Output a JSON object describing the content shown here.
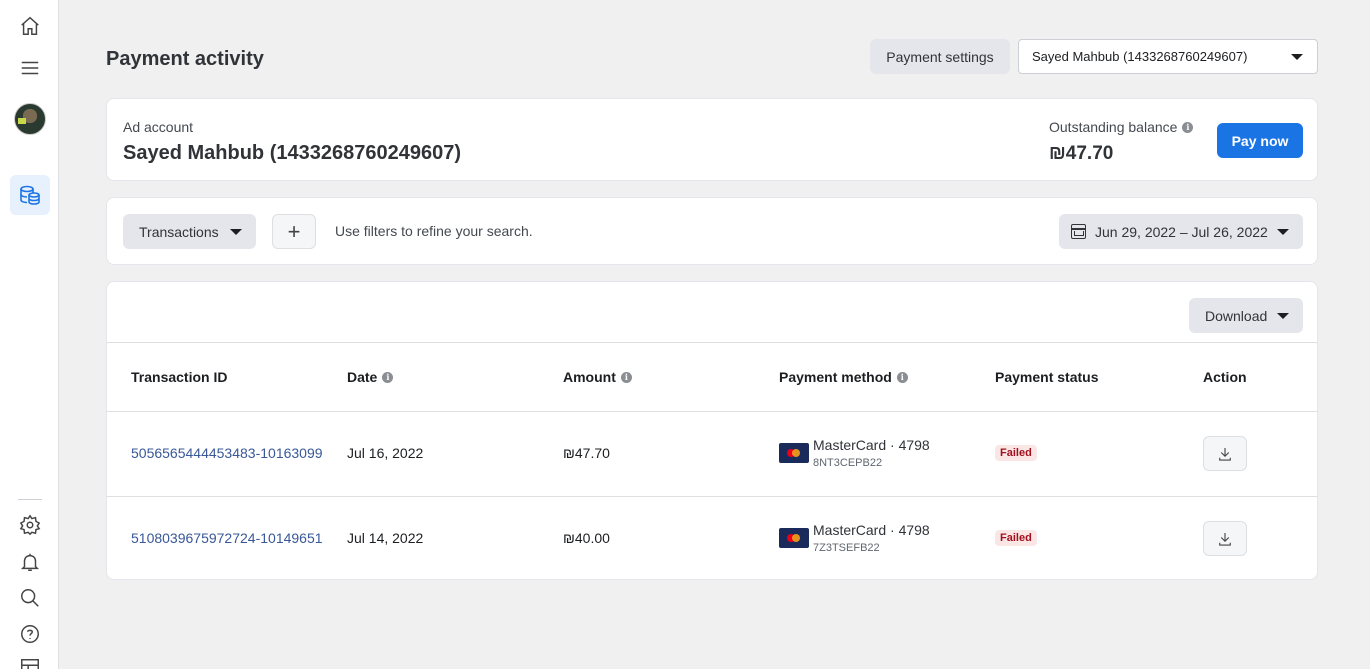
{
  "header": {
    "title": "Payment activity",
    "payment_settings_label": "Payment settings",
    "account_selector": "Sayed Mahbub (1433268760249607)"
  },
  "account_card": {
    "label": "Ad account",
    "name": "Sayed Mahbub (1433268760249607)",
    "balance_label": "Outstanding balance",
    "balance_value": "₪47.70",
    "pay_now_label": "Pay now"
  },
  "filters": {
    "type_label": "Transactions",
    "add_label": "+",
    "hint": "Use filters to refine your search.",
    "date_range": "Jun 29, 2022 – Jul 26, 2022"
  },
  "table": {
    "download_label": "Download",
    "columns": [
      "Transaction ID",
      "Date",
      "Amount",
      "Payment method",
      "Payment status",
      "Action"
    ],
    "rows": [
      {
        "id": "5056565444453483-10163099",
        "date": "Jul 16, 2022",
        "amount": "₪47.70",
        "method_name": "MasterCard · 4798",
        "method_code": "8NT3CEPB22",
        "status": "Failed"
      },
      {
        "id": "5108039675972724-10149651",
        "date": "Jul 14, 2022",
        "amount": "₪40.00",
        "method_name": "MasterCard · 4798",
        "method_code": "7Z3TSEFB22",
        "status": "Failed"
      }
    ]
  },
  "colors": {
    "primary": "#1b74e4",
    "link": "#385898",
    "failed_bg": "#fbe6e6",
    "failed_text": "#a0101e"
  },
  "icons": {
    "sidebar": [
      "home-icon",
      "menu-icon",
      "avatar",
      "billing-icon",
      "settings-icon",
      "bell-icon",
      "search-icon",
      "help-icon",
      "reports-icon"
    ]
  }
}
